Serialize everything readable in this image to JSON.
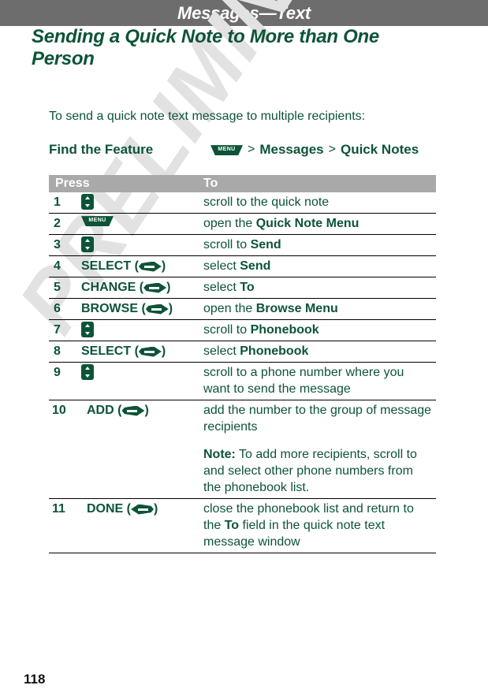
{
  "header": {
    "title": "Messages—Text",
    "bar_color": "#6d6d6d"
  },
  "watermark": {
    "text": "PRELIMINARY",
    "color": "#e2e2e2"
  },
  "section": {
    "heading": "Sending a Quick Note to More than One Person",
    "intro": "To send a quick note text message to multiple recipients:",
    "accent_color": "#0d5437"
  },
  "find_the_feature": {
    "label": "Find the Feature",
    "menu_key_label": "MENU",
    "separator": ">",
    "path_item_1": "Messages",
    "path_item_2": "Quick Notes"
  },
  "table": {
    "header": {
      "press": "Press",
      "to": "To",
      "background": "#a9a9a9"
    },
    "rows": [
      {
        "num": "1",
        "key_icon": "scroll-key",
        "key_label": "",
        "desc_prefix": "scroll to the quick note",
        "desc_bold": "",
        "desc_suffix": ""
      },
      {
        "num": "2",
        "key_icon": "menu-key",
        "key_label": "MENU",
        "desc_prefix": "open the ",
        "desc_bold": "Quick Note Menu",
        "desc_suffix": ""
      },
      {
        "num": "3",
        "key_icon": "scroll-key",
        "key_label": "",
        "desc_prefix": "scroll to ",
        "desc_bold": "Send",
        "desc_suffix": ""
      },
      {
        "num": "4",
        "key_icon": "soft-key-right",
        "key_label": "SELECT",
        "desc_prefix": "select ",
        "desc_bold": "Send",
        "desc_suffix": ""
      },
      {
        "num": "5",
        "key_icon": "soft-key-right",
        "key_label": "CHANGE",
        "desc_prefix": "select ",
        "desc_bold": "To",
        "desc_suffix": ""
      },
      {
        "num": "6",
        "key_icon": "soft-key-right",
        "key_label": "BROWSE",
        "desc_prefix": "open the ",
        "desc_bold": "Browse Menu",
        "desc_suffix": ""
      },
      {
        "num": "7",
        "key_icon": "scroll-key",
        "key_label": "",
        "desc_prefix": "scroll to ",
        "desc_bold": "Phonebook",
        "desc_suffix": ""
      },
      {
        "num": "8",
        "key_icon": "soft-key-right",
        "key_label": "SELECT",
        "desc_prefix": "select ",
        "desc_bold": "Phonebook",
        "desc_suffix": ""
      },
      {
        "num": "9",
        "key_icon": "scroll-key",
        "key_label": "",
        "desc_prefix": "scroll to a phone number where you want to send the message",
        "desc_bold": "",
        "desc_suffix": ""
      },
      {
        "num": "10",
        "key_icon": "soft-key-right",
        "key_label": "ADD",
        "desc_prefix": "add the number to the group of message recipients",
        "desc_bold": "",
        "desc_suffix": "",
        "note_label": "Note:",
        "note_text": " To add more recipients, scroll to and select other phone numbers from the phonebook list."
      },
      {
        "num": "11",
        "key_icon": "soft-key-left",
        "key_label": "DONE",
        "desc_prefix": "close the phonebook list and return to the ",
        "desc_bold": "To",
        "desc_suffix": " field in the quick note text message window"
      }
    ]
  },
  "footer": {
    "page_number": "118"
  }
}
